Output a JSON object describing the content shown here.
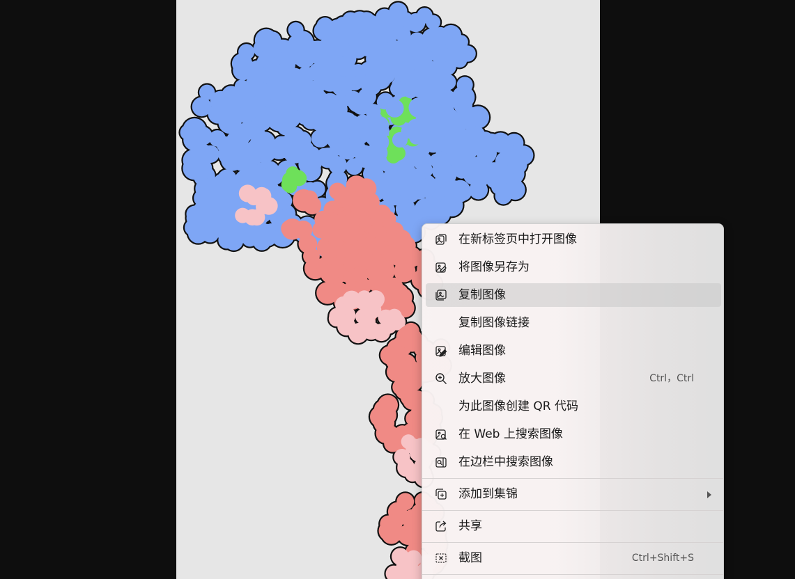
{
  "image": {
    "subject": "protein-molecule-image",
    "colors": {
      "blue_domain": "#7ea6f5",
      "green_site": "#6ee05a",
      "red_domain": "#f08a85",
      "pink_domain": "#f7c3c6",
      "outline": "#111111"
    }
  },
  "context_menu": {
    "items": [
      {
        "label": "在新标签页中打开图像",
        "icon": "open-in-new-tab-icon",
        "shortcut": ""
      },
      {
        "label": "将图像另存为",
        "icon": "save-image-icon",
        "shortcut": ""
      },
      {
        "label": "复制图像",
        "icon": "copy-image-icon",
        "shortcut": "",
        "highlighted": true
      },
      {
        "label": "复制图像链接",
        "icon": "",
        "shortcut": ""
      },
      {
        "label": "编辑图像",
        "icon": "edit-image-icon",
        "shortcut": ""
      },
      {
        "label": "放大图像",
        "icon": "zoom-in-icon",
        "shortcut": "Ctrl，Ctrl"
      },
      {
        "label": "为此图像创建 QR 代码",
        "icon": "",
        "shortcut": ""
      },
      {
        "label": "在 Web 上搜索图像",
        "icon": "search-web-icon",
        "shortcut": ""
      },
      {
        "label": "在边栏中搜索图像",
        "icon": "search-sidebar-icon",
        "shortcut": ""
      },
      {
        "label": "添加到集锦",
        "icon": "add-to-collection-icon",
        "shortcut": "",
        "submenu": true
      },
      {
        "label": "共享",
        "icon": "share-icon",
        "shortcut": ""
      },
      {
        "label": "截图",
        "icon": "screenshot-icon",
        "shortcut": "Ctrl+Shift+S"
      }
    ]
  }
}
